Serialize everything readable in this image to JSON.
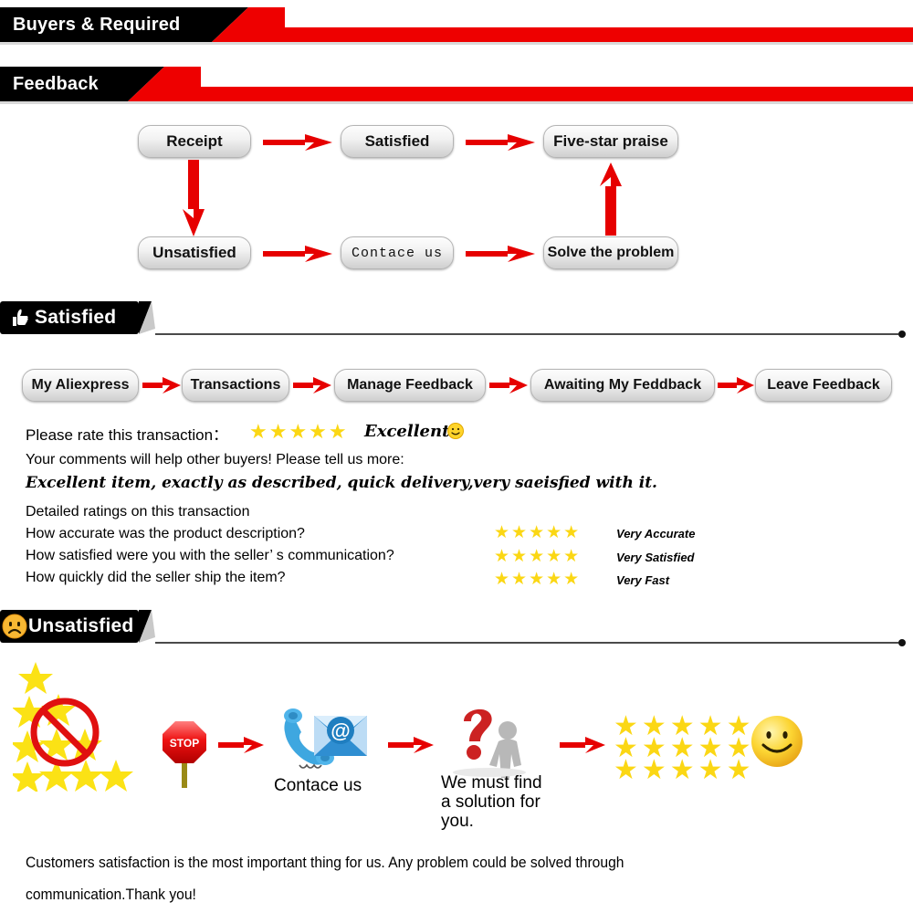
{
  "banners": {
    "top": {
      "title": "Buyers & Required"
    },
    "feedback": {
      "title": "Feedback"
    },
    "satisfied": {
      "title": "Satisfied",
      "icon": "thumbs-up-icon"
    },
    "unsatisfied": {
      "title": "Unsatisfied",
      "icon": "sad-face-icon"
    }
  },
  "flow": {
    "nodes": [
      {
        "label": "Receipt"
      },
      {
        "label": "Satisfied"
      },
      {
        "label": "Five-star praise"
      },
      {
        "label": "Unsatisfied"
      },
      {
        "label": "Contace us"
      },
      {
        "label": "Solve the problem"
      }
    ]
  },
  "breadcrumb": {
    "steps": [
      {
        "label": "My Aliexpress"
      },
      {
        "label": "Transactions"
      },
      {
        "label": "Manage Feedback"
      },
      {
        "label": "Awaiting My Feddback"
      },
      {
        "label": "Leave Feedback"
      }
    ]
  },
  "rating": {
    "prompt": "Please rate this transaction：",
    "stars": 5,
    "star_glyph": "★",
    "grade": "Excellent",
    "grade_face": "smiley-icon",
    "comments_prompt": "Your comments will help other buyers! Please tell us more:",
    "comment_text": "Excellent item, exactly as described, quick delivery,very saeisfied with it.",
    "detailed_heading": "Detailed ratings on this transaction",
    "detailed": [
      {
        "question": "How accurate was the product description?",
        "stars": 5,
        "label": "Very Accurate"
      },
      {
        "question": "How satisfied were you with the seller’ s communication?",
        "stars": 5,
        "label": "Very Satisfied"
      },
      {
        "question": "How quickly did the seller ship the item?",
        "stars": 5,
        "label": "Very Fast"
      }
    ]
  },
  "unsatisfied_flow": {
    "bad_stars_icon": "no-stars-icon",
    "stop_icon": "stop-sign-icon",
    "stop_label": "STOP",
    "contact_icon": "phone-email-icon",
    "contact_label": "Contace us",
    "question_icon": "question-mark-person-icon",
    "question_label": "We must find\na solution for\nyou.",
    "question_label_lines": [
      "We must find",
      "a solution for",
      "you."
    ],
    "good_stars_rows": 3,
    "good_stars_per_row": 5,
    "happy_icon": "smiley-face-icon"
  },
  "footer": {
    "line1": "Customers satisfaction is the most important thing for us. Any problem could be solved through",
    "line2": "communication.Thank you!"
  },
  "colors": {
    "red": "#ee0000",
    "arrow_red": "#e60000",
    "star_yellow": "#fbd714",
    "black": "#000000",
    "pill_border": "#b4b4b4"
  }
}
